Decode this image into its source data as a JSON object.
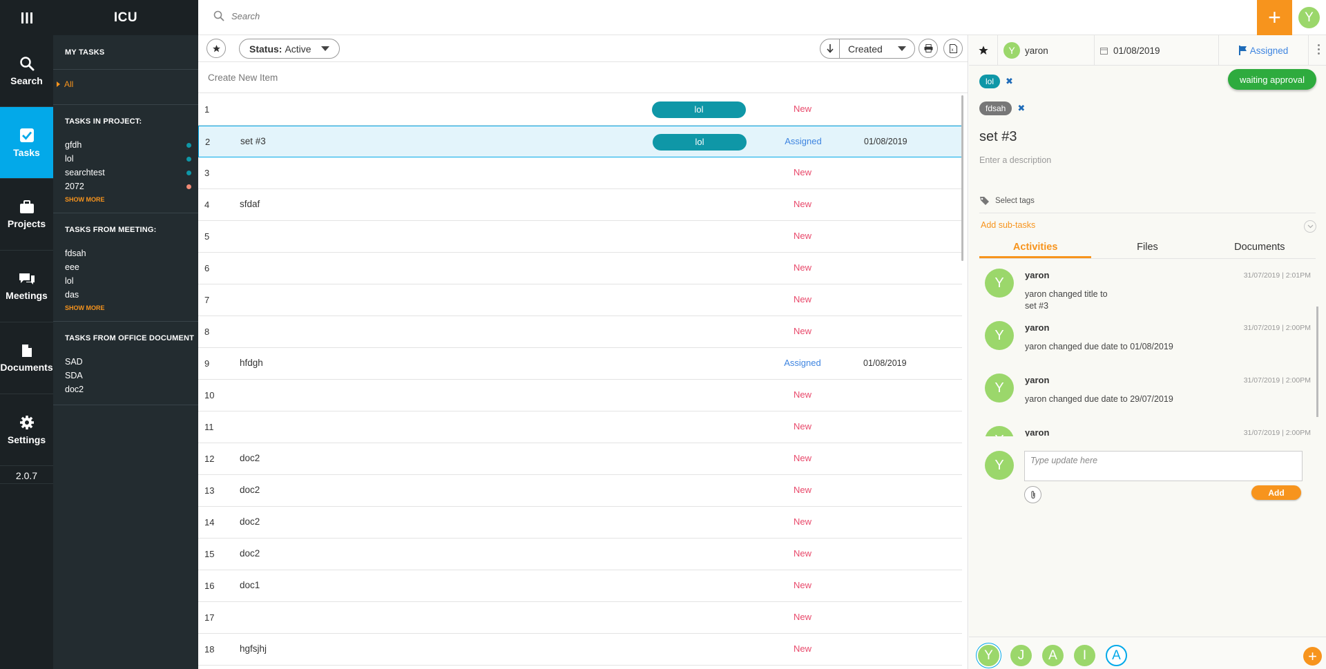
{
  "app": {
    "brand": "ICU",
    "version": "2.0.7"
  },
  "nav": [
    {
      "label": "Search",
      "icon": "search-icon",
      "active": false
    },
    {
      "label": "Tasks",
      "icon": "check-icon",
      "active": true
    },
    {
      "label": "Projects",
      "icon": "briefcase-icon",
      "active": false
    },
    {
      "label": "Meetings",
      "icon": "chat-icon",
      "active": false
    },
    {
      "label": "Documents",
      "icon": "document-icon",
      "active": false
    },
    {
      "label": "Settings",
      "icon": "gear-icon",
      "active": false
    }
  ],
  "sidebar": {
    "my_tasks": "MY TASKS",
    "all": "All",
    "tasks_in_project": {
      "title": "TASKS IN PROJECT:",
      "items": [
        {
          "label": "gfdh",
          "dot": "#0f97a7"
        },
        {
          "label": "lol",
          "dot": "#0f97a7"
        },
        {
          "label": "searchtest",
          "dot": "#0f97a7"
        },
        {
          "label": "2072",
          "dot": "#f08a75"
        }
      ],
      "more": "SHOW MORE"
    },
    "tasks_from_meeting": {
      "title": "TASKS FROM MEETING:",
      "items": [
        "fdsah",
        "eee",
        "lol",
        "das"
      ],
      "more": "SHOW MORE"
    },
    "tasks_from_office": {
      "title": "TASKS FROM OFFICE DOCUMENT",
      "items": [
        "SAD",
        "SDA",
        "doc2"
      ]
    }
  },
  "topbar": {
    "search_placeholder": "Search",
    "user_initial": "Y",
    "plus": "+"
  },
  "toolbar": {
    "status_label": "Status:",
    "status_value": "Active",
    "sort_value": "Created"
  },
  "list": {
    "create_new": "Create New Item",
    "rows": [
      {
        "num": "1",
        "title": "",
        "tag": "lol",
        "status": "New",
        "due": ""
      },
      {
        "num": "2",
        "title": "set #3",
        "tag": "lol",
        "status": "Assigned",
        "due": "01/08/2019"
      },
      {
        "num": "3",
        "title": "",
        "tag": "",
        "status": "New",
        "due": ""
      },
      {
        "num": "4",
        "title": "sfdaf",
        "tag": "",
        "status": "New",
        "due": ""
      },
      {
        "num": "5",
        "title": "",
        "tag": "",
        "status": "New",
        "due": ""
      },
      {
        "num": "6",
        "title": "",
        "tag": "",
        "status": "New",
        "due": ""
      },
      {
        "num": "7",
        "title": "",
        "tag": "",
        "status": "New",
        "due": ""
      },
      {
        "num": "8",
        "title": "",
        "tag": "",
        "status": "New",
        "due": ""
      },
      {
        "num": "9",
        "title": "hfdgh",
        "tag": "",
        "status": "Assigned",
        "due": "01/08/2019"
      },
      {
        "num": "10",
        "title": "",
        "tag": "",
        "status": "New",
        "due": ""
      },
      {
        "num": "11",
        "title": "",
        "tag": "",
        "status": "New",
        "due": ""
      },
      {
        "num": "12",
        "title": "doc2",
        "tag": "",
        "status": "New",
        "due": ""
      },
      {
        "num": "13",
        "title": "doc2",
        "tag": "",
        "status": "New",
        "due": ""
      },
      {
        "num": "14",
        "title": "doc2",
        "tag": "",
        "status": "New",
        "due": ""
      },
      {
        "num": "15",
        "title": "doc2",
        "tag": "",
        "status": "New",
        "due": ""
      },
      {
        "num": "16",
        "title": "doc1",
        "tag": "",
        "status": "New",
        "due": ""
      },
      {
        "num": "17",
        "title": "",
        "tag": "",
        "status": "New",
        "due": ""
      },
      {
        "num": "18",
        "title": "hgfsjhj",
        "tag": "",
        "status": "New",
        "due": ""
      }
    ]
  },
  "detail": {
    "assignee": "yaron",
    "assignee_initial": "Y",
    "due": "01/08/2019",
    "status": "Assigned",
    "waiting": "waiting approval",
    "tags": [
      {
        "label": "lol",
        "color": "#0f97a7"
      },
      {
        "label": "fdsah",
        "color": "#777777"
      }
    ],
    "title": "set #3",
    "description_placeholder": "Enter a description",
    "select_tags": "Select tags",
    "add_subtasks": "Add sub-tasks",
    "tabs": [
      "Activities",
      "Files",
      "Documents"
    ],
    "activities": [
      {
        "initial": "Y",
        "who": "yaron",
        "when": "31/07/2019 | 2:01PM",
        "line1": "yaron changed title to",
        "line2": "set #3"
      },
      {
        "initial": "Y",
        "who": "yaron",
        "when": "31/07/2019 | 2:00PM",
        "line1": "yaron changed due date to 01/08/2019",
        "line2": ""
      },
      {
        "initial": "Y",
        "who": "yaron",
        "when": "31/07/2019 | 2:00PM",
        "line1": "yaron changed due date to 29/07/2019",
        "line2": ""
      },
      {
        "initial": "Y",
        "who": "yaron",
        "when": "31/07/2019 | 2:00PM",
        "line1": "",
        "line2": ""
      }
    ],
    "update_placeholder": "Type update here",
    "add_button": "Add",
    "watchers": [
      "Y",
      "J",
      "A",
      "I",
      "A"
    ]
  }
}
